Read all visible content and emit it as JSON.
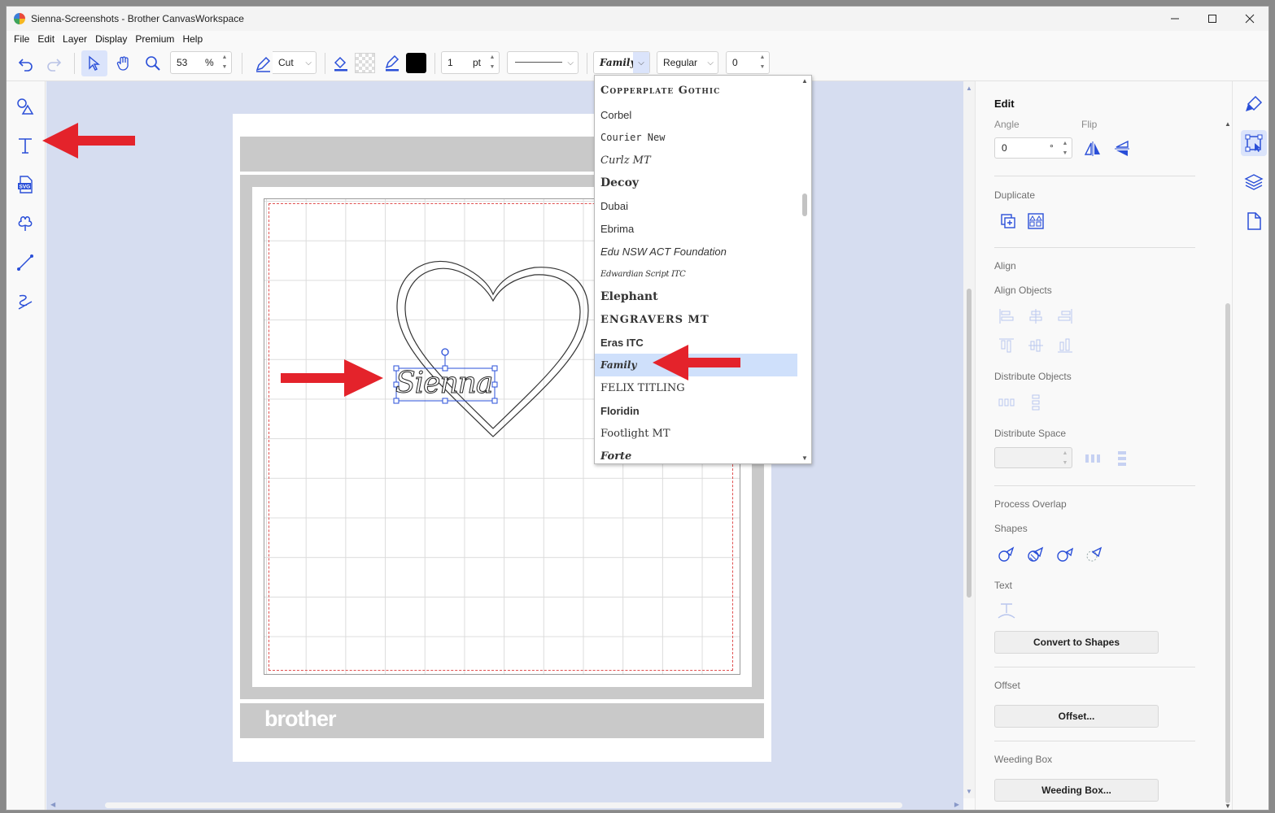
{
  "window": {
    "title": "Sienna-Screenshots - Brother CanvasWorkspace",
    "controls": [
      "minimize-icon",
      "maximize-icon",
      "close-icon"
    ]
  },
  "menu": [
    "File",
    "Edit",
    "Layer",
    "Display",
    "Premium",
    "Help"
  ],
  "toolbar": {
    "zoom_value": "53",
    "zoom_unit": "%",
    "line_mode": "Cut",
    "line_width": "1",
    "line_width_unit": "pt",
    "font_family": "Family",
    "font_style": "Regular",
    "char_spacing": "0",
    "fill_color": "#000000"
  },
  "left_tools": [
    "shapes-icon",
    "text-icon",
    "svg-import-icon",
    "pattern-icon",
    "line-icon",
    "freehand-icon"
  ],
  "canvas": {
    "brand_text": "brother",
    "selected_text": "Sienna"
  },
  "font_dropdown": {
    "items": [
      "Copperplate Gothic",
      "Corbel",
      "Courier New",
      "Curlz MT",
      "Decoy",
      "Dubai",
      "Ebrima",
      "Edu NSW ACT Foundation",
      "Edwardian Script ITC",
      "Elephant",
      "ENGRAVERS MT",
      "Eras ITC",
      "Family",
      "FELIX TITLING",
      "Floridin",
      "Footlight MT",
      "Forte"
    ],
    "selected_index": 12
  },
  "right_panel": {
    "title": "Edit",
    "angle_label": "Angle",
    "angle_value": "0",
    "angle_unit": "°",
    "flip_label": "Flip",
    "duplicate_label": "Duplicate",
    "align_label": "Align",
    "align_objects_label": "Align Objects",
    "distribute_objects_label": "Distribute Objects",
    "distribute_space_label": "Distribute Space",
    "process_overlap_label": "Process Overlap",
    "shapes_label": "Shapes",
    "text_label": "Text",
    "convert_button": "Convert to Shapes",
    "offset_label": "Offset",
    "offset_button": "Offset...",
    "weeding_label": "Weeding Box",
    "weeding_button": "Weeding Box..."
  },
  "right_tabs": [
    "brush-icon",
    "edit-transform-icon",
    "layers-icon",
    "page-icon"
  ],
  "colors": {
    "accent": "#2a4fd8",
    "annotation_arrow": "#e4232b",
    "canvas_bg": "#d6ddf0",
    "selected_font_bg": "#cfe0fb"
  }
}
